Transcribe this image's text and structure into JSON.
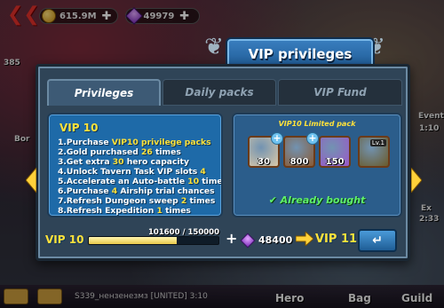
{
  "topbar": {
    "gold": "615.9M",
    "gems": "49979"
  },
  "side_labels": {
    "left_level": "385",
    "left_bor": "Bor",
    "right_event": "Event",
    "right_time1": "1:10",
    "right_ex": "Ex",
    "right_time2": "2:33"
  },
  "bottombar": {
    "chat_text": "S339_нензенезмз [UNITED] 3:10",
    "hero": "Hero",
    "bag": "Bag",
    "guild": "Guild"
  },
  "modal": {
    "title": "VIP privileges",
    "tabs": [
      {
        "label": "Privileges",
        "active": true
      },
      {
        "label": "Daily packs",
        "active": false
      },
      {
        "label": "VIP Fund",
        "active": false
      }
    ],
    "left": {
      "heading": "VIP 10",
      "privileges": [
        {
          "pre": "1.Purchase ",
          "hl": "VIP10 privilege packs",
          "post": ""
        },
        {
          "pre": "2.Gold purchased ",
          "hl": "26",
          "post": " times"
        },
        {
          "pre": "3.Get extra ",
          "hl": "30",
          "post": " hero capacity"
        },
        {
          "pre": "4.Unlock Tavern Task VIP slots ",
          "hl": "4",
          "post": ""
        },
        {
          "pre": "5.Accelerate an Auto-battle ",
          "hl": "10",
          "post": " times"
        },
        {
          "pre": "6.Purchase ",
          "hl": "4",
          "post": " Airship trial chances"
        },
        {
          "pre": "7.Refresh Dungeon sweep ",
          "hl": "2",
          "post": " times"
        },
        {
          "pre": "8.Refresh Expedition ",
          "hl": "1",
          "post": " times"
        }
      ]
    },
    "right": {
      "title": "VIP10 Limited pack",
      "items": [
        {
          "name": "hero-card-icon",
          "qty": "30",
          "color": "#d9c8a8"
        },
        {
          "name": "treasure-item-icon",
          "qty": "800",
          "color": "#8a5a34"
        },
        {
          "name": "potion-icon",
          "qty": "150",
          "color": "#9a58c8"
        },
        {
          "name": "chest-icon",
          "qty": "",
          "level": "Lv.1",
          "color": "#6a5a2a"
        }
      ],
      "status": "Already bought"
    },
    "progress": {
      "current_vip": "VIP 10",
      "text": "101600 / 150000",
      "ratio": 0.677,
      "gems_needed": "48400",
      "next_vip": "VIP 11"
    }
  },
  "colors": {
    "accent_yellow": "#ffe23a",
    "bought_green": "#5ff06a",
    "panel_blue": "#1e6aa8"
  }
}
